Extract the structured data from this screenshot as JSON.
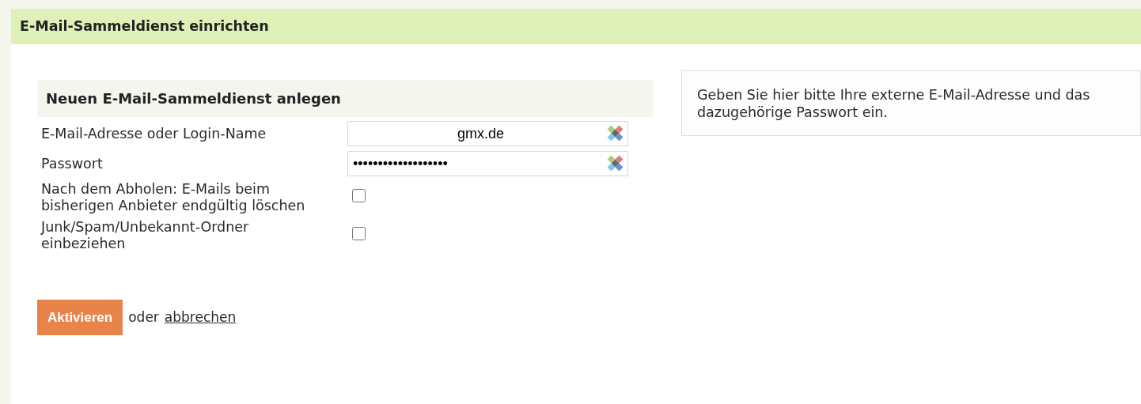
{
  "page_title": "E-Mail-Sammeldienst einrichten",
  "form": {
    "title": "Neuen E-Mail-Sammeldienst anlegen",
    "fields": [
      {
        "kind": "text",
        "label": "E-Mail-Adresse oder Login-Name",
        "value": "gmx.de"
      },
      {
        "kind": "password",
        "label": "Passwort",
        "value": "•••••••••••••••••••"
      },
      {
        "kind": "checkbox",
        "label": "Nach dem Abholen: E-Mails beim bisherigen Anbieter endgültig löschen",
        "checked": false
      },
      {
        "kind": "checkbox",
        "label": "Junk/Spam/Unbekannt-Ordner einbeziehen",
        "checked": false
      }
    ],
    "submit": "Aktivieren",
    "separator": "oder",
    "cancel": "abbrechen"
  },
  "hint": "Geben Sie hier bitte Ihre externe E-Mail-Adresse und das dazugehörige Passwort ein."
}
